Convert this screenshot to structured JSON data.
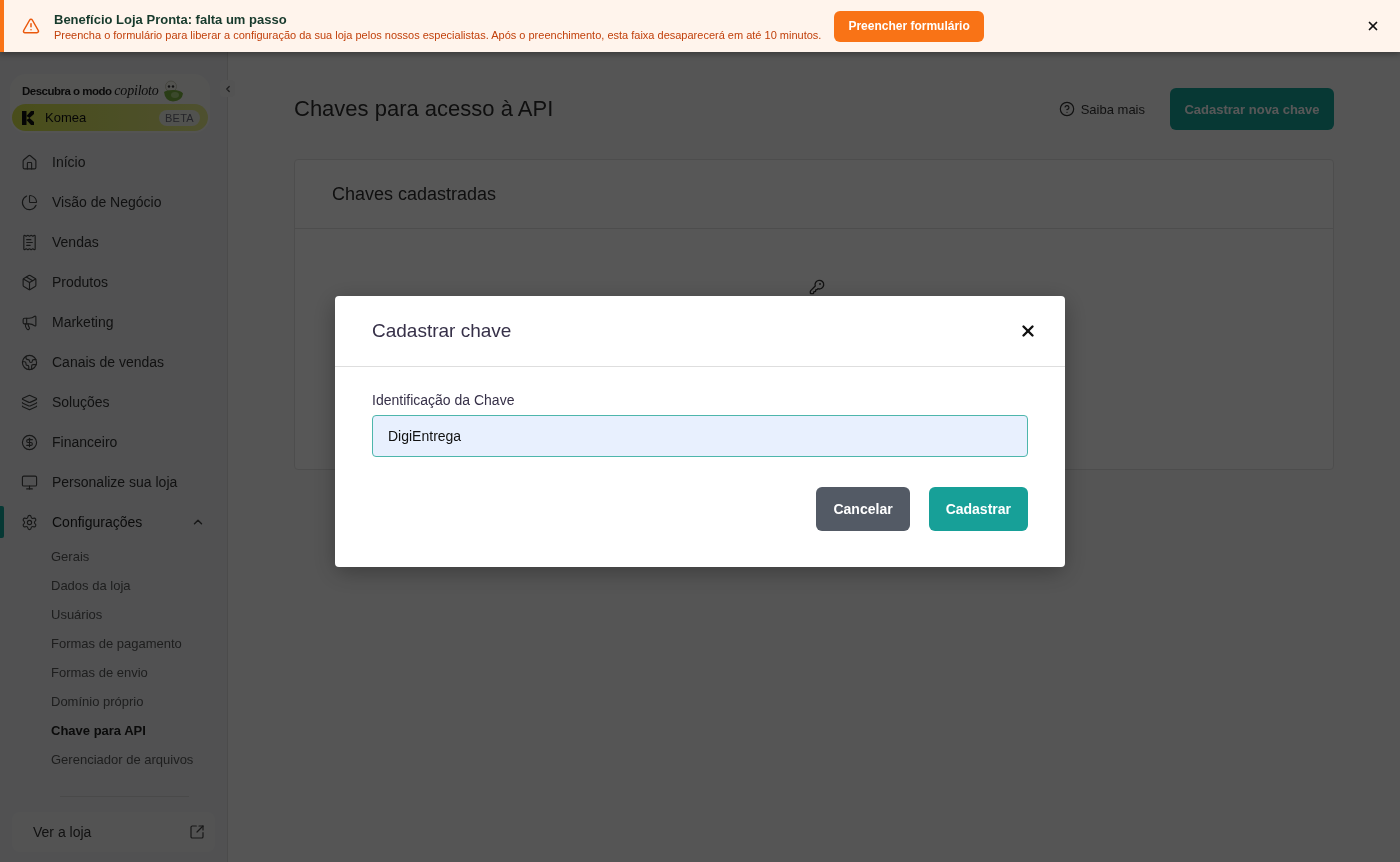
{
  "banner": {
    "title": "Benefício Loja Pronta: falta um passo",
    "message": "Preencha o formulário para liberar a configuração da sua loja pelos nossos especialistas. Após o preenchimento, esta faixa desaparecerá em até 10 minutos.",
    "button": "Preencher formulário"
  },
  "sidebar": {
    "promo": {
      "headline": "Descubra o modo *copiloto*",
      "brand": "Komea",
      "badge": "BETA"
    },
    "items": [
      {
        "label": "Início",
        "selected": false
      },
      {
        "label": "Visão de Negócio",
        "selected": false
      },
      {
        "label": "Vendas",
        "selected": false
      },
      {
        "label": "Produtos",
        "selected": false
      },
      {
        "label": "Marketing",
        "selected": false
      },
      {
        "label": "Canais de vendas",
        "selected": false
      },
      {
        "label": "Soluções",
        "selected": false
      },
      {
        "label": "Financeiro",
        "selected": false
      },
      {
        "label": "Personalize sua loja",
        "selected": false
      },
      {
        "label": "Configurações",
        "selected": true,
        "expanded": true,
        "children": [
          {
            "label": "Gerais",
            "selected": false
          },
          {
            "label": "Dados da loja",
            "selected": false
          },
          {
            "label": "Usuários",
            "selected": false
          },
          {
            "label": "Formas de pagamento",
            "selected": false
          },
          {
            "label": "Formas de envio",
            "selected": false
          },
          {
            "label": "Domínio próprio",
            "selected": false
          },
          {
            "label": "Chave para API",
            "selected": true
          },
          {
            "label": "Gerenciador de arquivos",
            "selected": false
          }
        ]
      }
    ],
    "footer_link": "Ver a loja"
  },
  "page": {
    "title": "Chaves para acesso à API",
    "help_link": "Saiba mais",
    "new_button": "Cadastrar nova chave",
    "card": {
      "title": "Chaves cadastradas"
    }
  },
  "modal": {
    "title": "Cadastrar chave",
    "field": {
      "label": "Identificação da Chave",
      "value": "DigiEntrega"
    },
    "buttons": [
      {
        "label": "Cancelar",
        "kind": "secondary"
      },
      {
        "label": "Cadastrar",
        "kind": "primary"
      }
    ]
  }
}
